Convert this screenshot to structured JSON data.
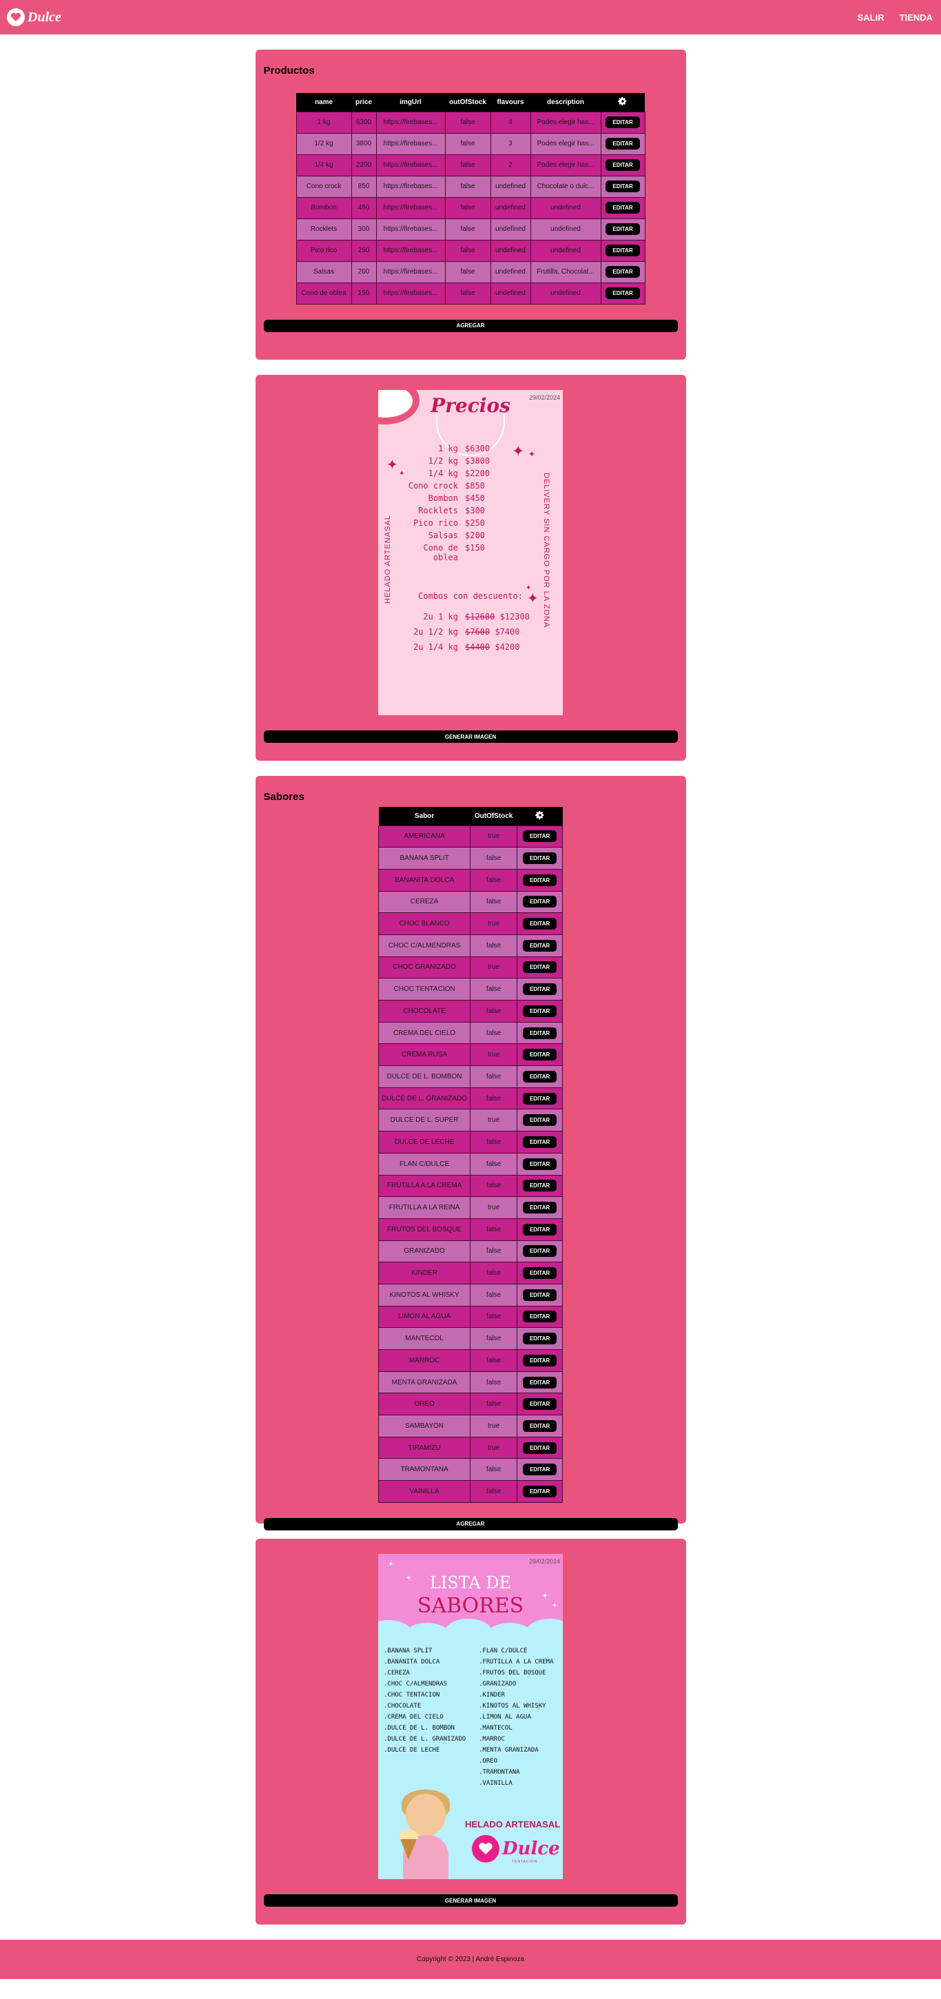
{
  "header": {
    "logo_text": "Dulce",
    "nav": [
      "SALIR",
      "TIENDA"
    ]
  },
  "products": {
    "title": "Productos",
    "columns": [
      "name",
      "price",
      "imgUrl",
      "outOfStock",
      "flavours",
      "description"
    ],
    "rows": [
      [
        "1 kg",
        "6300",
        "https://firebases...",
        "false",
        "4",
        "Podes elegir has..."
      ],
      [
        "1/2 kg",
        "3800",
        "https://firebases...",
        "false",
        "3",
        "Podes elegir has..."
      ],
      [
        "1/4 kg",
        "2200",
        "https://firebases...",
        "false",
        "2",
        "Podes elegir has..."
      ],
      [
        "Cono crock",
        "850",
        "https://firebases...",
        "false",
        "undefined",
        "Chocolate o dulc..."
      ],
      [
        "Bombon",
        "450",
        "https://firebases...",
        "false",
        "undefined",
        "undefined"
      ],
      [
        "Rocklets",
        "300",
        "https://firebases...",
        "false",
        "undefined",
        "undefined"
      ],
      [
        "Pico rico",
        "250",
        "https://firebases...",
        "false",
        "undefined",
        "undefined"
      ],
      [
        "Salsas",
        "200",
        "https://firebases...",
        "false",
        "undefined",
        "Frutilla, Chocolat..."
      ],
      [
        "Cono de oblea",
        "150",
        "https://firebases...",
        "false",
        "undefined",
        "undefined"
      ]
    ],
    "edit_label": "EDITAR",
    "add_label": "AGREGAR"
  },
  "price_poster": {
    "date": "29/02/2024",
    "title": "Precios",
    "left_vertical": "HELADO ARTENASAL",
    "right_vertical": "DELIVERY SIN CARGO POR LA ZONA",
    "items": [
      {
        "name": "1 kg",
        "price": "$6300"
      },
      {
        "name": "1/2 kg",
        "price": "$3800"
      },
      {
        "name": "1/4 kg",
        "price": "$2200"
      },
      {
        "name": "Cono crock",
        "price": "$850"
      },
      {
        "name": "Bombon",
        "price": "$450"
      },
      {
        "name": "Rocklets",
        "price": "$300"
      },
      {
        "name": "Pico rico",
        "price": "$250"
      },
      {
        "name": "Salsas",
        "price": "$200"
      },
      {
        "name": "Cono de oblea",
        "price": "$150"
      }
    ],
    "combos_title": "Combos con descuento:",
    "combos": [
      {
        "name": "2u 1 kg",
        "old": "$12600",
        "new": "$12300"
      },
      {
        "name": "2u 1/2 kg",
        "old": "$7600",
        "new": "$7400"
      },
      {
        "name": "2u 1/4 kg",
        "old": "$4400",
        "new": "$4200"
      }
    ],
    "button_label": "GENERAR IMAGEN"
  },
  "flavours": {
    "title": "Sabores",
    "columns": [
      "Sabor",
      "OutOfStock"
    ],
    "rows": [
      [
        "AMERICANA",
        "true"
      ],
      [
        "BANANA SPLIT",
        "false"
      ],
      [
        "BANANITA DOLCA",
        "false"
      ],
      [
        "CEREZA",
        "false"
      ],
      [
        "CHOC BLANCO",
        "true"
      ],
      [
        "CHOC C/ALMENDRAS",
        "false"
      ],
      [
        "CHOC GRANIZADO",
        "true"
      ],
      [
        "CHOC TENTACION",
        "false"
      ],
      [
        "CHOCOLATE",
        "false"
      ],
      [
        "CREMA DEL CIELO",
        "false"
      ],
      [
        "CREMA RUSA",
        "true"
      ],
      [
        "DULCE DE L. BOMBON",
        "false"
      ],
      [
        "DULCE DE L. GRANIZADO",
        "false"
      ],
      [
        "DULCE DE L. SUPER",
        "true"
      ],
      [
        "DULCE DE LECHE",
        "false"
      ],
      [
        "FLAN C/DULCE",
        "false"
      ],
      [
        "FRUTILLA A LA CREMA",
        "false"
      ],
      [
        "FRUTILLA A LA REINA",
        "true"
      ],
      [
        "FRUTOS DEL BOSQUE",
        "false"
      ],
      [
        "GRANIZADO",
        "false"
      ],
      [
        "KINDER",
        "false"
      ],
      [
        "KINOTOS AL WHISKY",
        "false"
      ],
      [
        "LIMON AL AGUA",
        "false"
      ],
      [
        "MANTECOL",
        "false"
      ],
      [
        "MARROC",
        "false"
      ],
      [
        "MENTA GRANIZADA",
        "false"
      ],
      [
        "OREO",
        "false"
      ],
      [
        "SAMBAYON",
        "true"
      ],
      [
        "TIRAMIZU",
        "true"
      ],
      [
        "TRAMONTANA",
        "false"
      ],
      [
        "VAINILLA",
        "false"
      ]
    ],
    "edit_label": "EDITAR",
    "add_label": "AGREGAR"
  },
  "flavour_poster": {
    "date": "29/02/2024",
    "title_line1": "LISTA DE",
    "title_line2": "SABORES",
    "col1": [
      ".BANANA SPLIT",
      ".BANANITA DOLCA",
      ".CEREZA",
      ".CHOC C/ALMENDRAS",
      ".CHOC TENTACION",
      ".CHOCOLATE",
      ".CREMA DEL CIELO",
      ".DULCE DE L. BOMBON",
      ".DULCE DE L. GRANIZADO",
      ".DULCE DE LECHE"
    ],
    "col2": [
      ".FLAN C/DULCE",
      ".FRUTILLA A LA CREMA",
      ".FRUTOS DEL BOSQUE",
      ".GRANIZADO",
      ".KINDER",
      ".KINOTOS AL WHISKY",
      ".LIMON AL AGUA",
      ".MANTECOL",
      ".MARROC",
      ".MENTA GRANIZADA",
      ".OREO",
      ".TRAMONTANA",
      ".VAINILLA"
    ],
    "brand_line": "HELADO ARTENASAL",
    "brand_name": "Dulce",
    "brand_sub": "TENTACION",
    "button_label": "GENERAR IMAGEN"
  },
  "footer": {
    "text": "Copyright © 2023 | André Espinoza"
  }
}
